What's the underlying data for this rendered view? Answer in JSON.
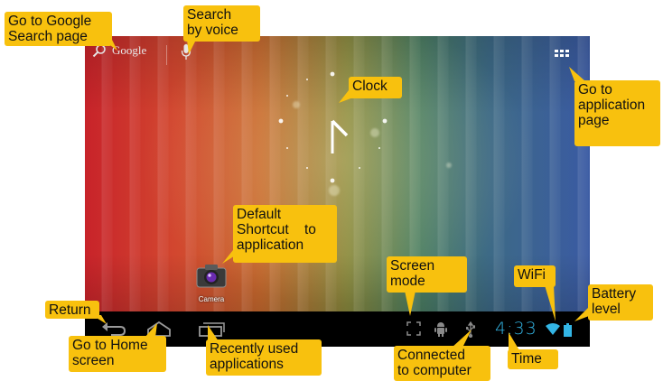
{
  "screen": {
    "google_label": "Google",
    "camera_label": "Camera",
    "time": "4:33"
  },
  "icons": {
    "search": "search-icon",
    "mic": "mic-icon",
    "apps": "apps-grid-icon",
    "back": "back-icon",
    "home": "home-icon",
    "recent": "recent-apps-icon",
    "screen_mode": "screen-mode-icon",
    "android": "android-debug-icon",
    "usb": "usb-icon",
    "wifi": "wifi-icon",
    "battery": "battery-icon"
  },
  "colors": {
    "callout_bg": "#f8c10e",
    "time_color": "#33b5e5",
    "navbar_bg": "#000000"
  },
  "callouts": {
    "google_search": [
      "Go to Google",
      "Search page"
    ],
    "voice": [
      "Search",
      "by voice"
    ],
    "clock": "Clock",
    "app_page": [
      "Go to",
      "application",
      "page"
    ],
    "default_shortcut": [
      "Default",
      "Shortcut    to",
      "application"
    ],
    "screen_mode": [
      "Screen",
      "mode"
    ],
    "wifi": "WiFi",
    "battery": [
      "Battery",
      "level"
    ],
    "return": "Return",
    "home": [
      "Go to Home",
      "screen"
    ],
    "recent": [
      "Recently used",
      "applications"
    ],
    "connected": [
      "Connected",
      "to computer"
    ],
    "time": "Time"
  }
}
